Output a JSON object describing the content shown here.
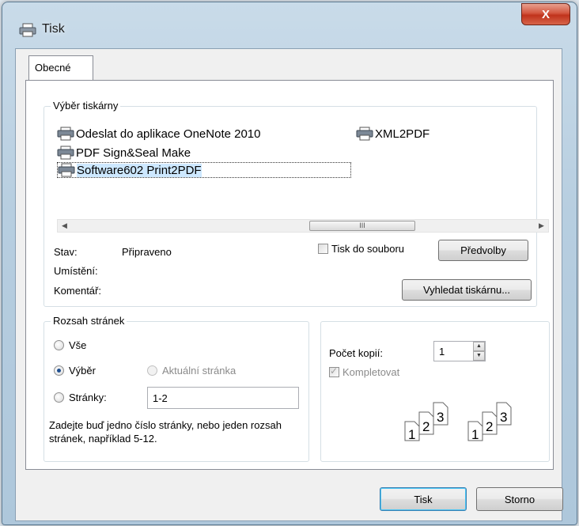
{
  "window": {
    "title": "Tisk",
    "close_glyph": "X"
  },
  "tabs": [
    {
      "label": "Obecné",
      "active": true
    }
  ],
  "printer_group": {
    "legend": "Výběr tiskárny",
    "printers": [
      {
        "name": "Odeslat do aplikace OneNote 2010",
        "icon": "printer-icon"
      },
      {
        "name": "XML2PDF",
        "icon": "printer-icon"
      },
      {
        "name": "PDF Sign&Seal Make",
        "icon": "printer-icon"
      },
      {
        "name": "Software602 Print2PDF",
        "icon": "printer-icon",
        "selected": true
      }
    ],
    "scroll_thumb_glyph": "III",
    "status_label": "Stav:",
    "status_value": "Připraveno",
    "location_label": "Umístění:",
    "comment_label": "Komentář:",
    "print_to_file_label": "Tisk do souboru",
    "print_to_file_checked": false,
    "preferences_button": "Předvolby",
    "find_printer_button": "Vyhledat tiskárnu..."
  },
  "page_range_group": {
    "legend": "Rozsah stránek",
    "all_label": "Vše",
    "selection_label": "Výběr",
    "current_page_label": "Aktuální stránka",
    "pages_label": "Stránky:",
    "pages_value": "1-2",
    "selected_option": "selection",
    "hint": "Zadejte buď jedno číslo stránky, nebo jeden rozsah stránek, například 5-12."
  },
  "copies_group": {
    "copies_label": "Počet kopií:",
    "copies_value": "1",
    "collate_label": "Kompletovat",
    "collate_checked": true,
    "collate_disabled": true,
    "page_numbers": [
      "1",
      "2",
      "3"
    ]
  },
  "footer": {
    "print_button": "Tisk",
    "cancel_button": "Storno"
  },
  "colors": {
    "close_button": "#c0331c",
    "selection_highlight": "#cde8ff",
    "default_button_border": "#3c7fb1"
  }
}
